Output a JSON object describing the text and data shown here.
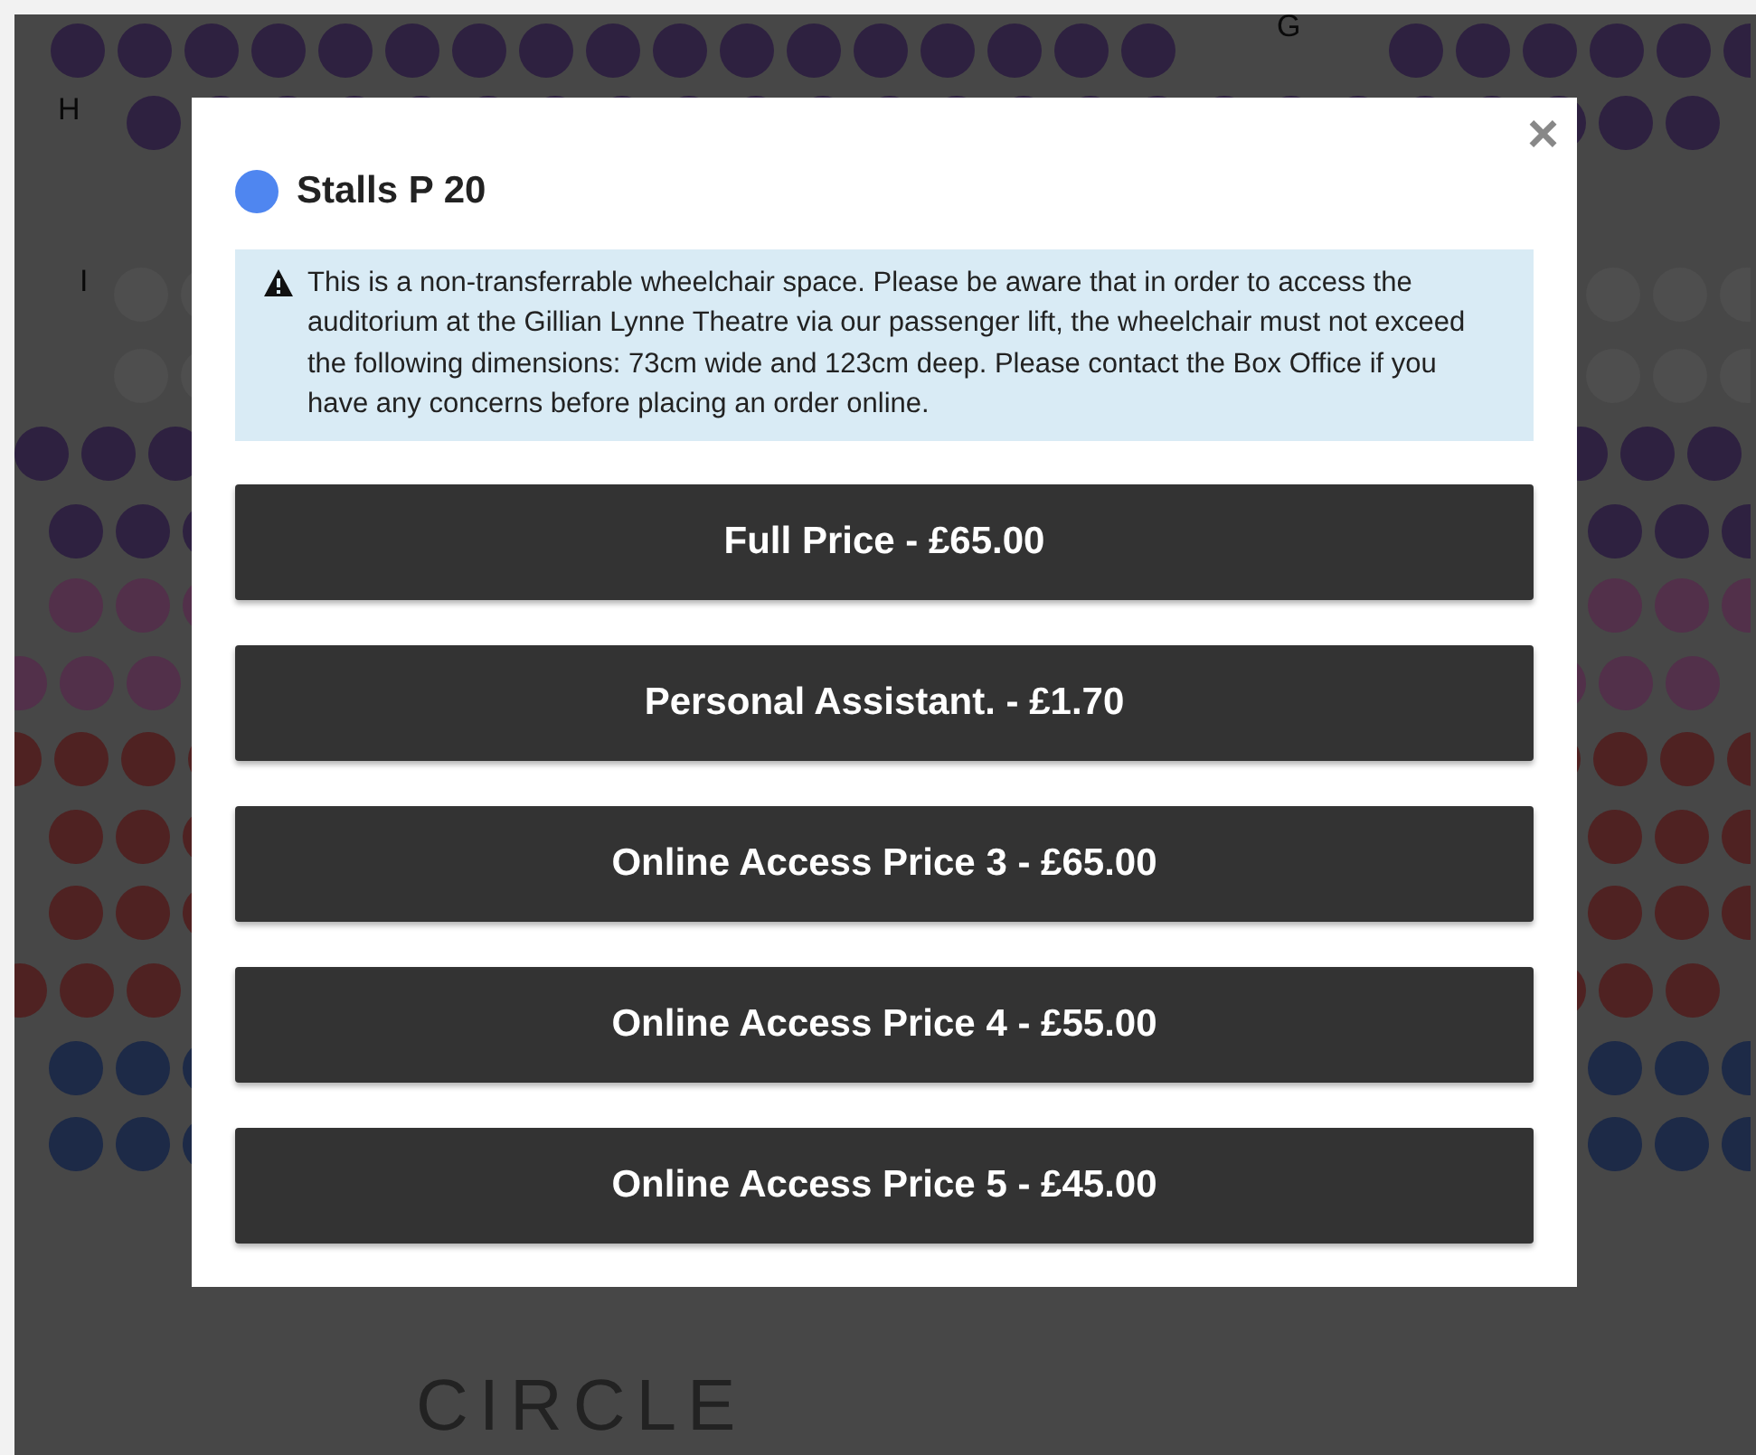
{
  "seat_map": {
    "row_labels": [
      "G",
      "H",
      "I"
    ],
    "section_heading": "CIRCLE"
  },
  "dialog": {
    "close": "×",
    "seat": {
      "label": "Stalls P 20",
      "color": "#4f86f0"
    },
    "notice": "This is a non-transferrable wheelchair space. Please be aware that in order to access the auditorium at the Gillian Lynne Theatre via our passenger lift, the wheelchair must not exceed the following dimensions: 73cm wide and 123cm deep. Please contact the Box Office if you have any concerns before placing an order online.",
    "price_options": [
      "Full Price - £65.00",
      "Personal Assistant. - £1.70",
      "Online Access Price 3 - £65.00",
      "Online Access Price 4 - £55.00",
      "Online Access Price 5 - £45.00"
    ]
  }
}
